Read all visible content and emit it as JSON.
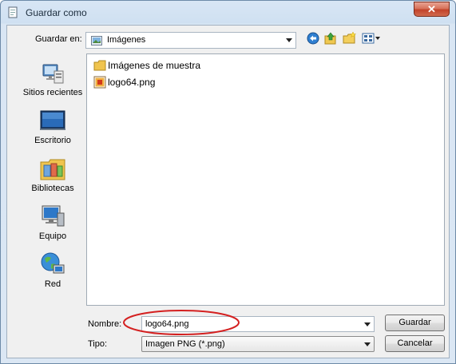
{
  "window": {
    "title": "Guardar como",
    "close_glyph": "✕"
  },
  "toolbar": {
    "save_in_label": "Guardar en:",
    "location_value": "Imágenes",
    "icons": [
      "back-icon",
      "up-folder-icon",
      "new-folder-icon",
      "view-menu-icon"
    ]
  },
  "places": [
    {
      "label": "Sitios recientes",
      "icon": "recent-places-icon"
    },
    {
      "label": "Escritorio",
      "icon": "desktop-icon"
    },
    {
      "label": "Bibliotecas",
      "icon": "libraries-icon"
    },
    {
      "label": "Equipo",
      "icon": "computer-icon"
    },
    {
      "label": "Red",
      "icon": "network-icon"
    }
  ],
  "files": [
    {
      "name": "Imágenes de muestra",
      "icon": "folder-icon"
    },
    {
      "name": "logo64.png",
      "icon": "png-file-icon"
    }
  ],
  "form": {
    "name_label": "Nombre:",
    "name_value": "logo64.png",
    "type_label": "Tipo:",
    "type_value": "Imagen PNG (*.png)",
    "save_button": "Guardar",
    "cancel_button": "Cancelar"
  },
  "annotation": {
    "color": "#d42020"
  }
}
